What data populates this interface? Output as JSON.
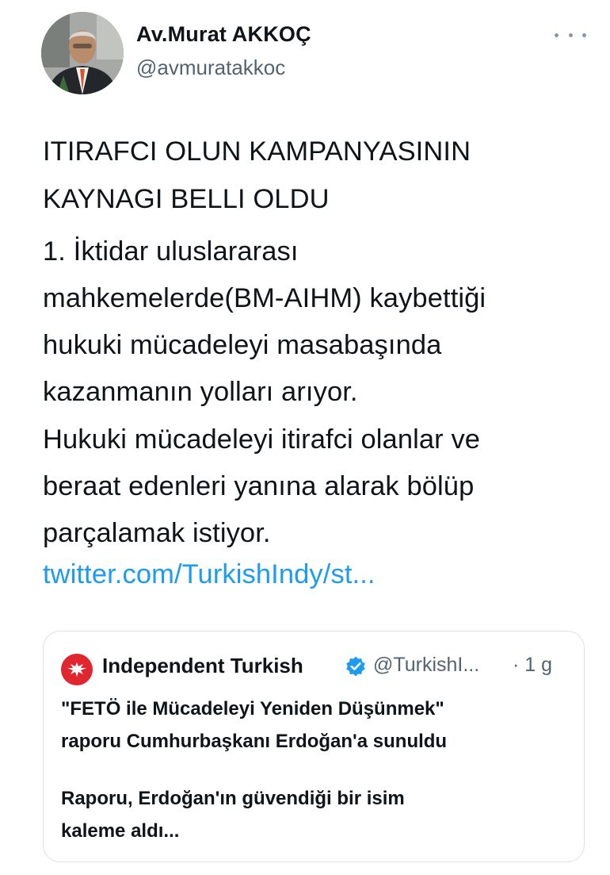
{
  "author": {
    "name": "Av.Murat AKKOÇ",
    "handle": "@avmuratakkoc",
    "avatar_icon": "profile-photo"
  },
  "more_icon": "more-horizontal-icon",
  "tweet": {
    "headline": "ITIRAFCI OLUN KAMPANYASININ\nKAYNAGI BELLI OLDU",
    "paragraph_1": "1. İktidar uluslararası\nmahkemelerde(BM-AIHM) kaybettiği\nhukuki mücadeleyi masabaşında\nkazanmanın yolları arıyor.",
    "paragraph_2": "Hukuki mücadeleyi itirafci olanlar ve\nberaat edenleri yanına alarak bölüp\nparçalamak istiyor.",
    "link_text": "twitter.com/TurkishIndy/st..."
  },
  "quoted_tweet": {
    "account_name": "Independent Turkish",
    "handle": "@TurkishI...",
    "time": "· 1 g",
    "headline": "\"FETÖ ile Mücadeleyi Yeniden Düşünmek\"\nraporu Cumhurbaşkanı Erdoğan'a sunuldu",
    "body": "Raporu, Erdoğan'ın güvendiği bir isim\nkaleme aldı..."
  },
  "colors": {
    "text": "#0f1419",
    "secondary": "#536471",
    "link": "#1d9bf0",
    "brand_red": "#e0262f",
    "verified_blue": "#1d9bf0",
    "border": "#dbe0e4"
  }
}
